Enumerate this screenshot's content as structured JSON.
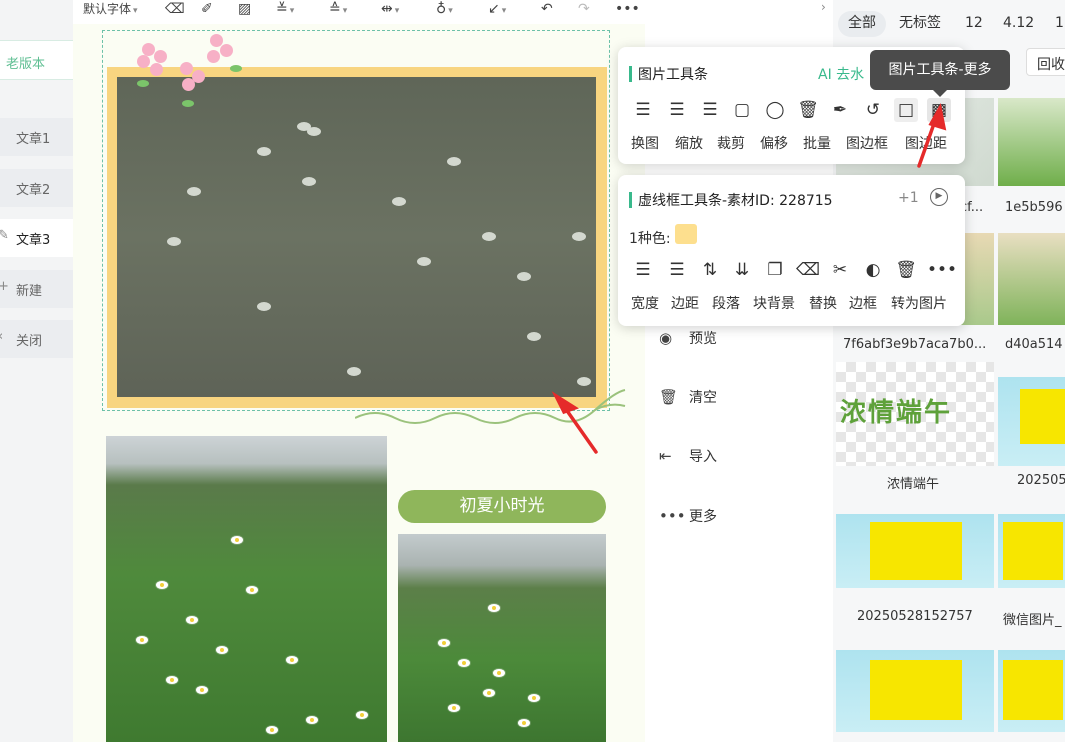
{
  "sidebar": {
    "old_version": "老版本",
    "items": [
      {
        "label": "文章1"
      },
      {
        "label": "文章2"
      },
      {
        "label": "文章3"
      },
      {
        "label": "新建"
      },
      {
        "label": "关闭"
      }
    ]
  },
  "toolbar": {
    "font": "默认字体"
  },
  "editor": {
    "title_pill": "初夏小时光"
  },
  "actions": [
    {
      "label": "预览",
      "icon": "eye-icon"
    },
    {
      "label": "清空",
      "icon": "trash-icon"
    },
    {
      "label": "导入",
      "icon": "import-icon"
    },
    {
      "label": "更多",
      "icon": "more-icon"
    }
  ],
  "image_toolbar": {
    "title": "图片工具条",
    "ai_link": "AI 去水",
    "tooltip": "图片工具条-更多",
    "buttons": [
      "换图",
      "缩放",
      "裁剪",
      "偏移",
      "批量",
      "图边框",
      "图边距"
    ]
  },
  "frame_toolbar": {
    "title": "虚线框工具条-素材ID: 228715",
    "plus": "+1",
    "color_label": "1种色:",
    "color": "#fddf8e",
    "buttons": [
      "宽度",
      "边距",
      "段落",
      "块背景",
      "替换",
      "边框",
      "转为图片"
    ]
  },
  "right_panel": {
    "tags": [
      "全部",
      "无标签",
      "12",
      "4.12",
      "1"
    ],
    "recycle": "回收",
    "labels": [
      "cf...",
      "1e5b596",
      "7f6abf3e9b7aca7b0...",
      "d40a514",
      "浓情端午",
      "202505",
      "20250528152757",
      "微信图片_"
    ],
    "sticker_text": "浓情端午"
  },
  "colors": {
    "accent": "#39b98c",
    "pill": "#8fb65b",
    "frame": "#f8d580",
    "arrow": "#e52a2a"
  }
}
